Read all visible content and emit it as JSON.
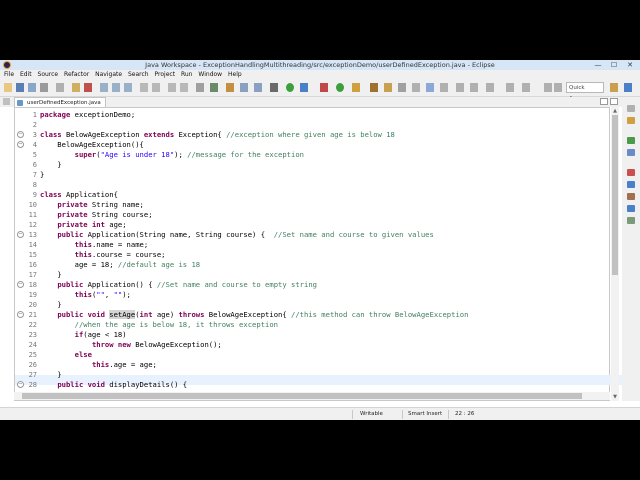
{
  "window": {
    "title": "Java Workspace - ExceptionHandlingMultithreading/src/exceptionDemo/userDefinedException.java - Eclipse",
    "controls": [
      "—",
      "☐",
      "✕"
    ]
  },
  "menu": {
    "items": [
      "File",
      "Edit",
      "Source",
      "Refactor",
      "Navigate",
      "Search",
      "Project",
      "Run",
      "Window",
      "Help"
    ]
  },
  "toolbar": {
    "quick_access": "Quick Access"
  },
  "editor": {
    "tab_label": "userDefinedException.java",
    "tab_close": "✕",
    "line_numbers": [
      "1",
      "2",
      "3",
      "4",
      "5",
      "6",
      "7",
      "8",
      "9",
      "10",
      "11",
      "12",
      "13",
      "14",
      "15",
      "16",
      "17",
      "18",
      "19",
      "20",
      "21",
      "22",
      "23",
      "24",
      "25",
      "26",
      "27",
      "28"
    ],
    "lines": [
      "package exceptionDemo;",
      "",
      "class BelowAgeException extends Exception{ //exception where given age is below 18",
      "    BelowAgeException(){",
      "        super(\"Age is under 18\"); //message for the exception",
      "    }",
      "}",
      "",
      "class Application{",
      "    private String name;",
      "    private String course;",
      "    private int age;",
      "    public Application(String name, String course) {  //Set name and course to given values",
      "        this.name = name;",
      "        this.course = course;",
      "        age = 18; //default age is 18",
      "    }",
      "    public Application() { //Set name and course to empty string",
      "        this(\"\", \"\");",
      "    }",
      "    public void setAge(int age) throws BelowAgeException{ //this method can throw BelowAgeException",
      "        //when the age is below 18, it throws exception",
      "        if(age < 18)",
      "            throw new BelowAgeException();",
      "        else",
      "            this.age = age;",
      "    }",
      "    public void displayDetails() {"
    ]
  },
  "status": {
    "writable": "Writable",
    "insert_mode": "Smart Insert",
    "position": "22 : 26"
  }
}
